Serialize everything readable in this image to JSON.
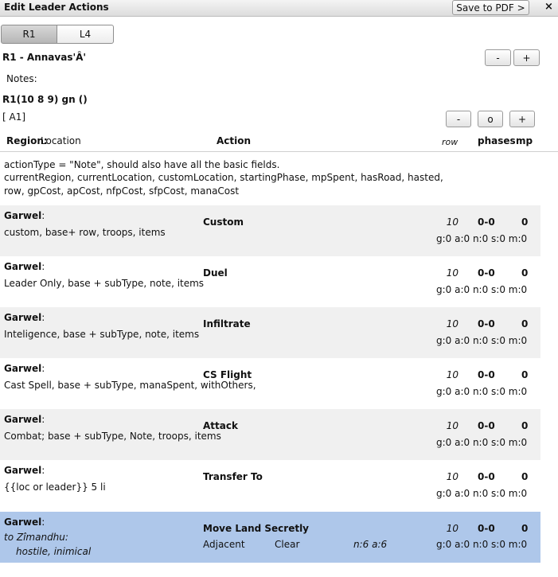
{
  "window": {
    "title": "Edit Leader Actions",
    "save_pdf_label": "Save to PDF >",
    "close_label": "×"
  },
  "tabs": [
    {
      "label": "R1",
      "active": true
    },
    {
      "label": "L4",
      "active": false
    }
  ],
  "leader_header": {
    "name": "R1 - Annavas'Â'",
    "minus_label": "-",
    "plus_label": "+"
  },
  "notes_label": "Notes:",
  "group": {
    "title": "R1(10 8 9) gn ()",
    "army": "[ A1]",
    "minus_label": "-",
    "o_label": "o",
    "plus_label": "+"
  },
  "columns": {
    "region": "Region:",
    "location": "Location",
    "action": "Action",
    "row": "row",
    "phases": "phases",
    "mp": "mp"
  },
  "note_lines": [
    "actionType = \"Note\", should also have all the basic fields.",
    "currentRegion, currentLocation, customLocation, startingPhase, mpSpent, hasRoad, hasted,",
    "row, gpCost, apCost, nfpCost, sfpCost, manaCost"
  ],
  "actions": [
    {
      "leader": "Garwel",
      "desc": "custom, base+ row, troops, items",
      "action": "Custom",
      "row": "10",
      "phases": "0-0",
      "mp": "0",
      "costs": "g:0 a:0 n:0 s:0 m:0"
    },
    {
      "leader": "Garwel",
      "desc": "Leader Only, base + subType, note, items",
      "action": "Duel",
      "row": "10",
      "phases": "0-0",
      "mp": "0",
      "costs": "g:0 a:0 n:0 s:0 m:0"
    },
    {
      "leader": "Garwel",
      "desc": "Inteligence, base + subType, note, items",
      "action": "Infiltrate",
      "row": "10",
      "phases": "0-0",
      "mp": "0",
      "costs": "g:0 a:0 n:0 s:0 m:0"
    },
    {
      "leader": "Garwel",
      "desc": "Cast Spell, base + subType, manaSpent, withOthers,",
      "action": "CS Flight",
      "row": "10",
      "phases": "0-0",
      "mp": "0",
      "costs": "g:0 a:0 n:0 s:0 m:0"
    },
    {
      "leader": "Garwel",
      "desc": "Combat; base + subType, Note, troops, items",
      "action": "Attack",
      "row": "10",
      "phases": "0-0",
      "mp": "0",
      "costs": "g:0 a:0 n:0 s:0 m:0"
    },
    {
      "leader": "Garwel",
      "desc": "{{loc or leader}} 5 li",
      "action": "Transfer To",
      "row": "10",
      "phases": "0-0",
      "mp": "0",
      "costs": "g:0 a:0 n:0 s:0 m:0"
    }
  ],
  "selected_action": {
    "leader": "Garwel",
    "destination": "to Zîmandhu:",
    "attitude": "hostile, inimical",
    "action": "Move Land Secretly",
    "terrain": "Adjacent",
    "weather": "Clear",
    "na": "n:6 a:6",
    "row": "10",
    "phases": "0-0",
    "mp": "0",
    "costs": "g:0 a:0 n:0 s:0 m:0"
  }
}
